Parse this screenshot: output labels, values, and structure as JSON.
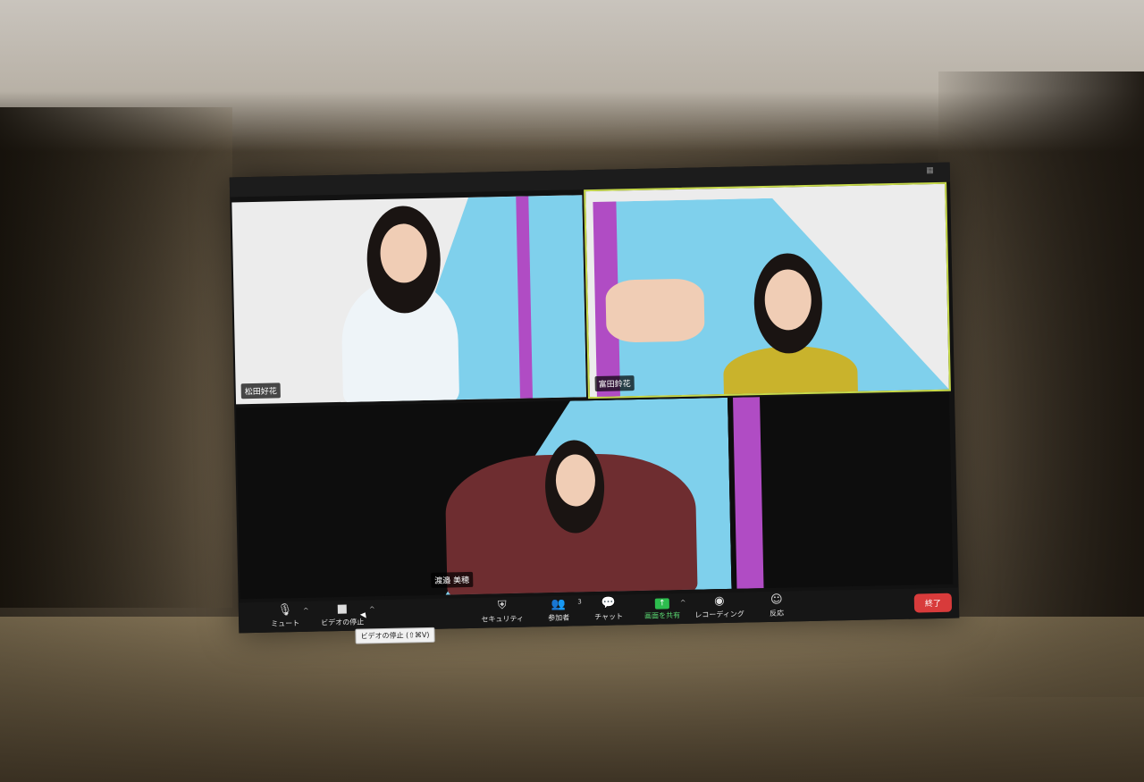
{
  "participants": [
    {
      "name": "松田好花"
    },
    {
      "name": "富田鈴花"
    },
    {
      "name": "渡邉 美穂"
    }
  ],
  "toolbar": {
    "mute_label": "ミュート",
    "video_label": "ビデオの停止",
    "security_label": "セキュリティ",
    "participants_label": "参加者",
    "participants_count": "3",
    "chat_label": "チャット",
    "share_label": "画面を共有",
    "record_label": "レコーディング",
    "reactions_label": "反応",
    "end_label": "終了"
  },
  "tooltip": "ビデオの停止 (⇧⌘V)",
  "icons": {
    "mute": "microphone-icon",
    "video": "video-camera-icon",
    "security": "shield-icon",
    "participants": "people-icon",
    "chat": "chat-bubble-icon",
    "share": "share-screen-arrow-icon",
    "record": "record-icon",
    "reactions": "emoji-icon"
  },
  "colors": {
    "active_speaker_outline": "#c6d94a",
    "end_button": "#d83b3b",
    "share_icon": "#2dbd4e",
    "backdrop_blue": "#7fd0ec",
    "backdrop_purple": "#b04cc4"
  }
}
